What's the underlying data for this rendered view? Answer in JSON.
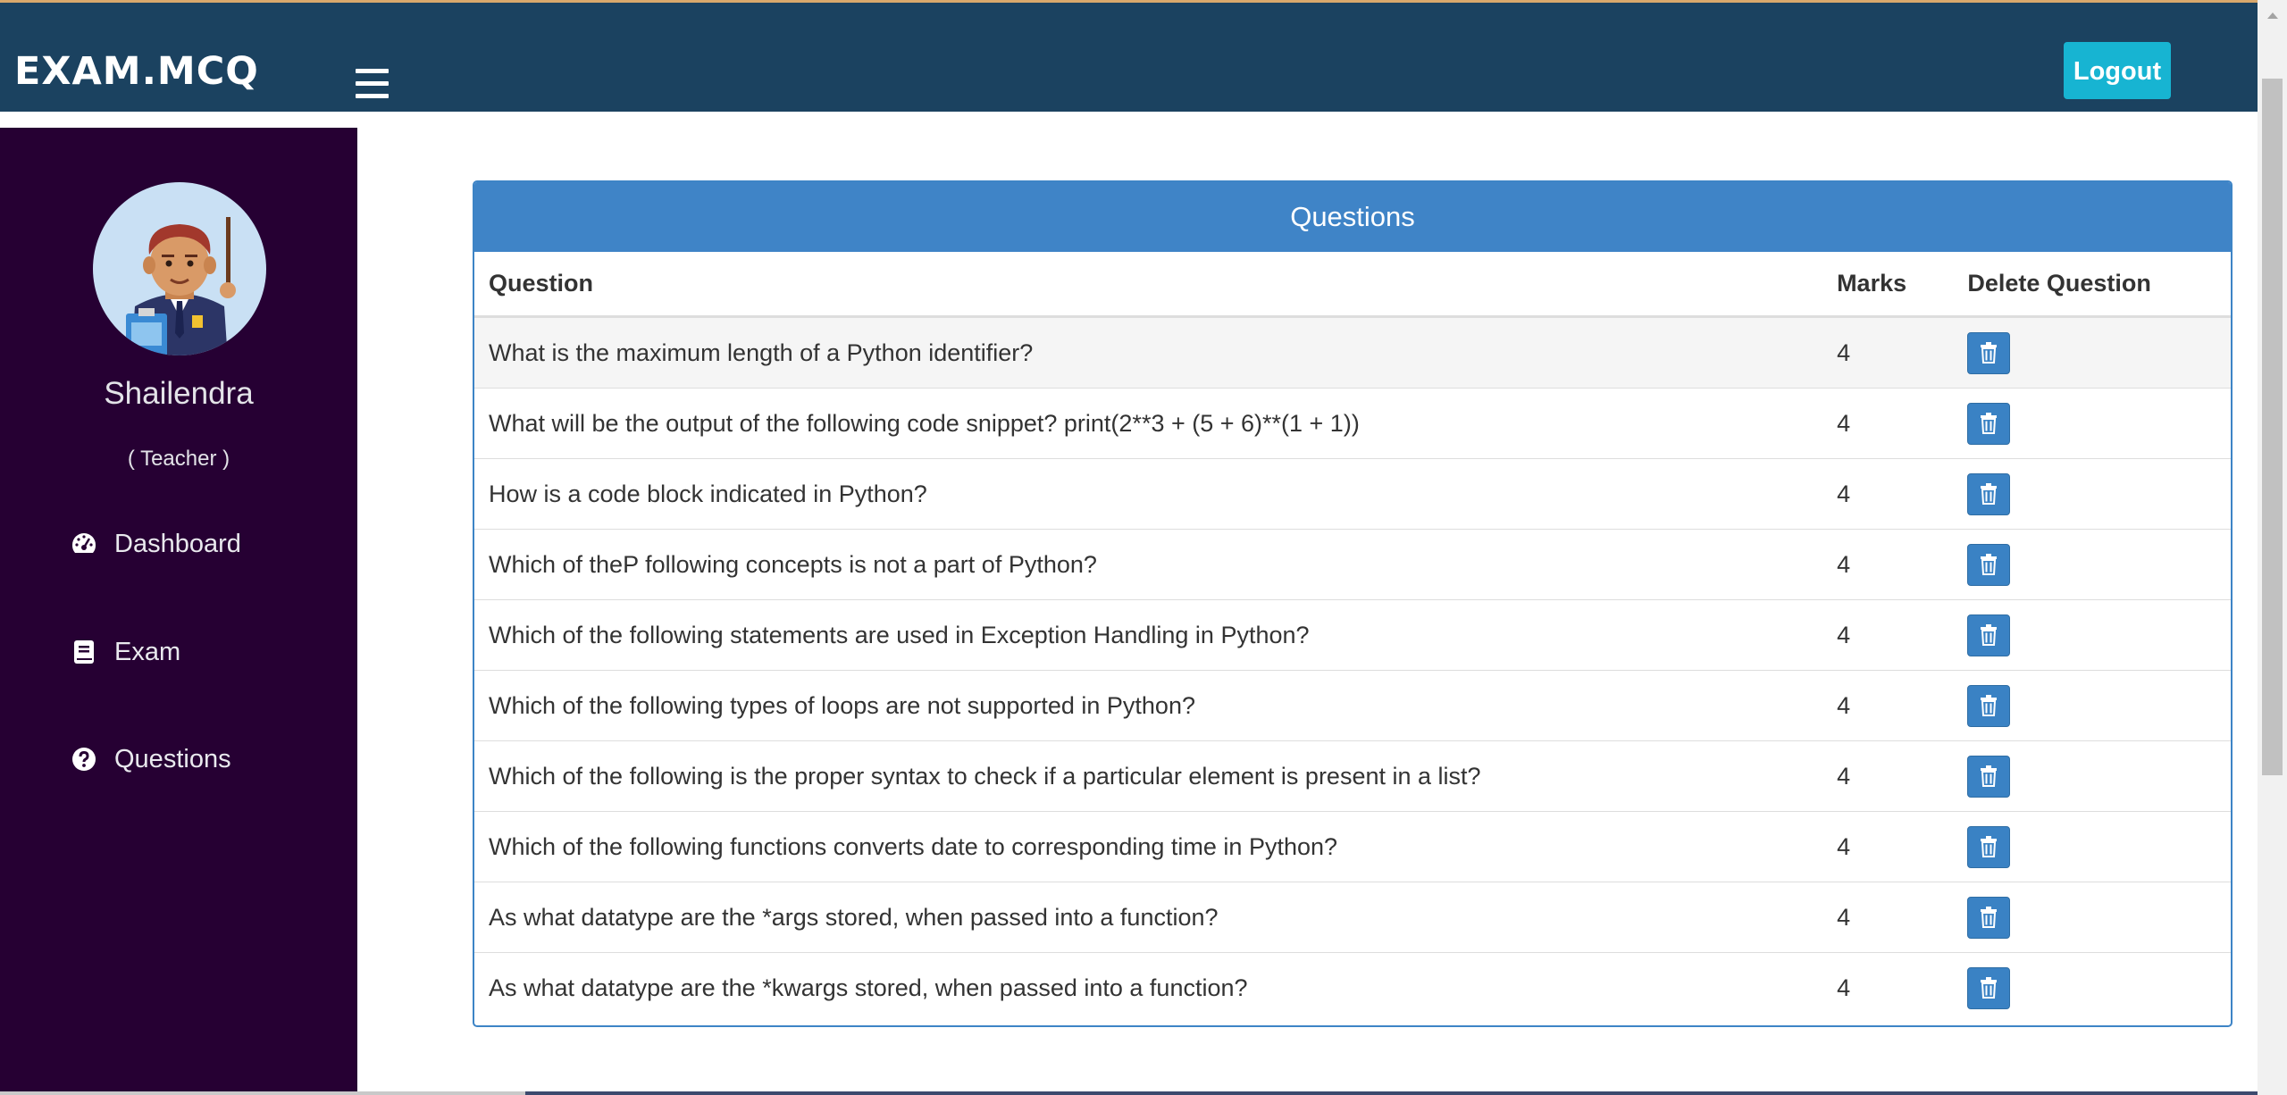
{
  "navbar": {
    "brand": "EXAM.MCQ",
    "logout_label": "Logout"
  },
  "sidebar": {
    "user_name": "Shailendra",
    "user_role": "( Teacher )",
    "items": [
      {
        "label": "Dashboard",
        "icon": "dashboard-icon"
      },
      {
        "label": "Exam",
        "icon": "book-icon"
      },
      {
        "label": "Questions",
        "icon": "question-circle-icon"
      }
    ]
  },
  "panel": {
    "title": "Questions",
    "columns": [
      "Question",
      "Marks",
      "Delete Question"
    ],
    "rows": [
      {
        "question": "What is the maximum length of a Python identifier?",
        "marks": "4"
      },
      {
        "question": "What will be the output of the following code snippet? print(2**3 + (5 + 6)**(1 + 1))",
        "marks": "4"
      },
      {
        "question": "How is a code block indicated in Python?",
        "marks": "4"
      },
      {
        "question": "Which of theP following concepts is not a part of Python?",
        "marks": "4"
      },
      {
        "question": "Which of the following statements are used in Exception Handling in Python?",
        "marks": "4"
      },
      {
        "question": "Which of the following types of loops are not supported in Python?",
        "marks": "4"
      },
      {
        "question": "Which of the following is the proper syntax to check if a particular element is present in a list?",
        "marks": "4"
      },
      {
        "question": "Which of the following functions converts date to corresponding time in Python?",
        "marks": "4"
      },
      {
        "question": "As what datatype are the *args stored, when passed into a function?",
        "marks": "4"
      },
      {
        "question": "As what datatype are the *kwargs stored, when passed into a function?",
        "marks": "4"
      }
    ]
  },
  "colors": {
    "navbar": "#1b4260",
    "sidebar": "#260033",
    "logout": "#17b4d2",
    "panel_heading": "#3f84c7",
    "delete_button": "#3a82c4"
  }
}
